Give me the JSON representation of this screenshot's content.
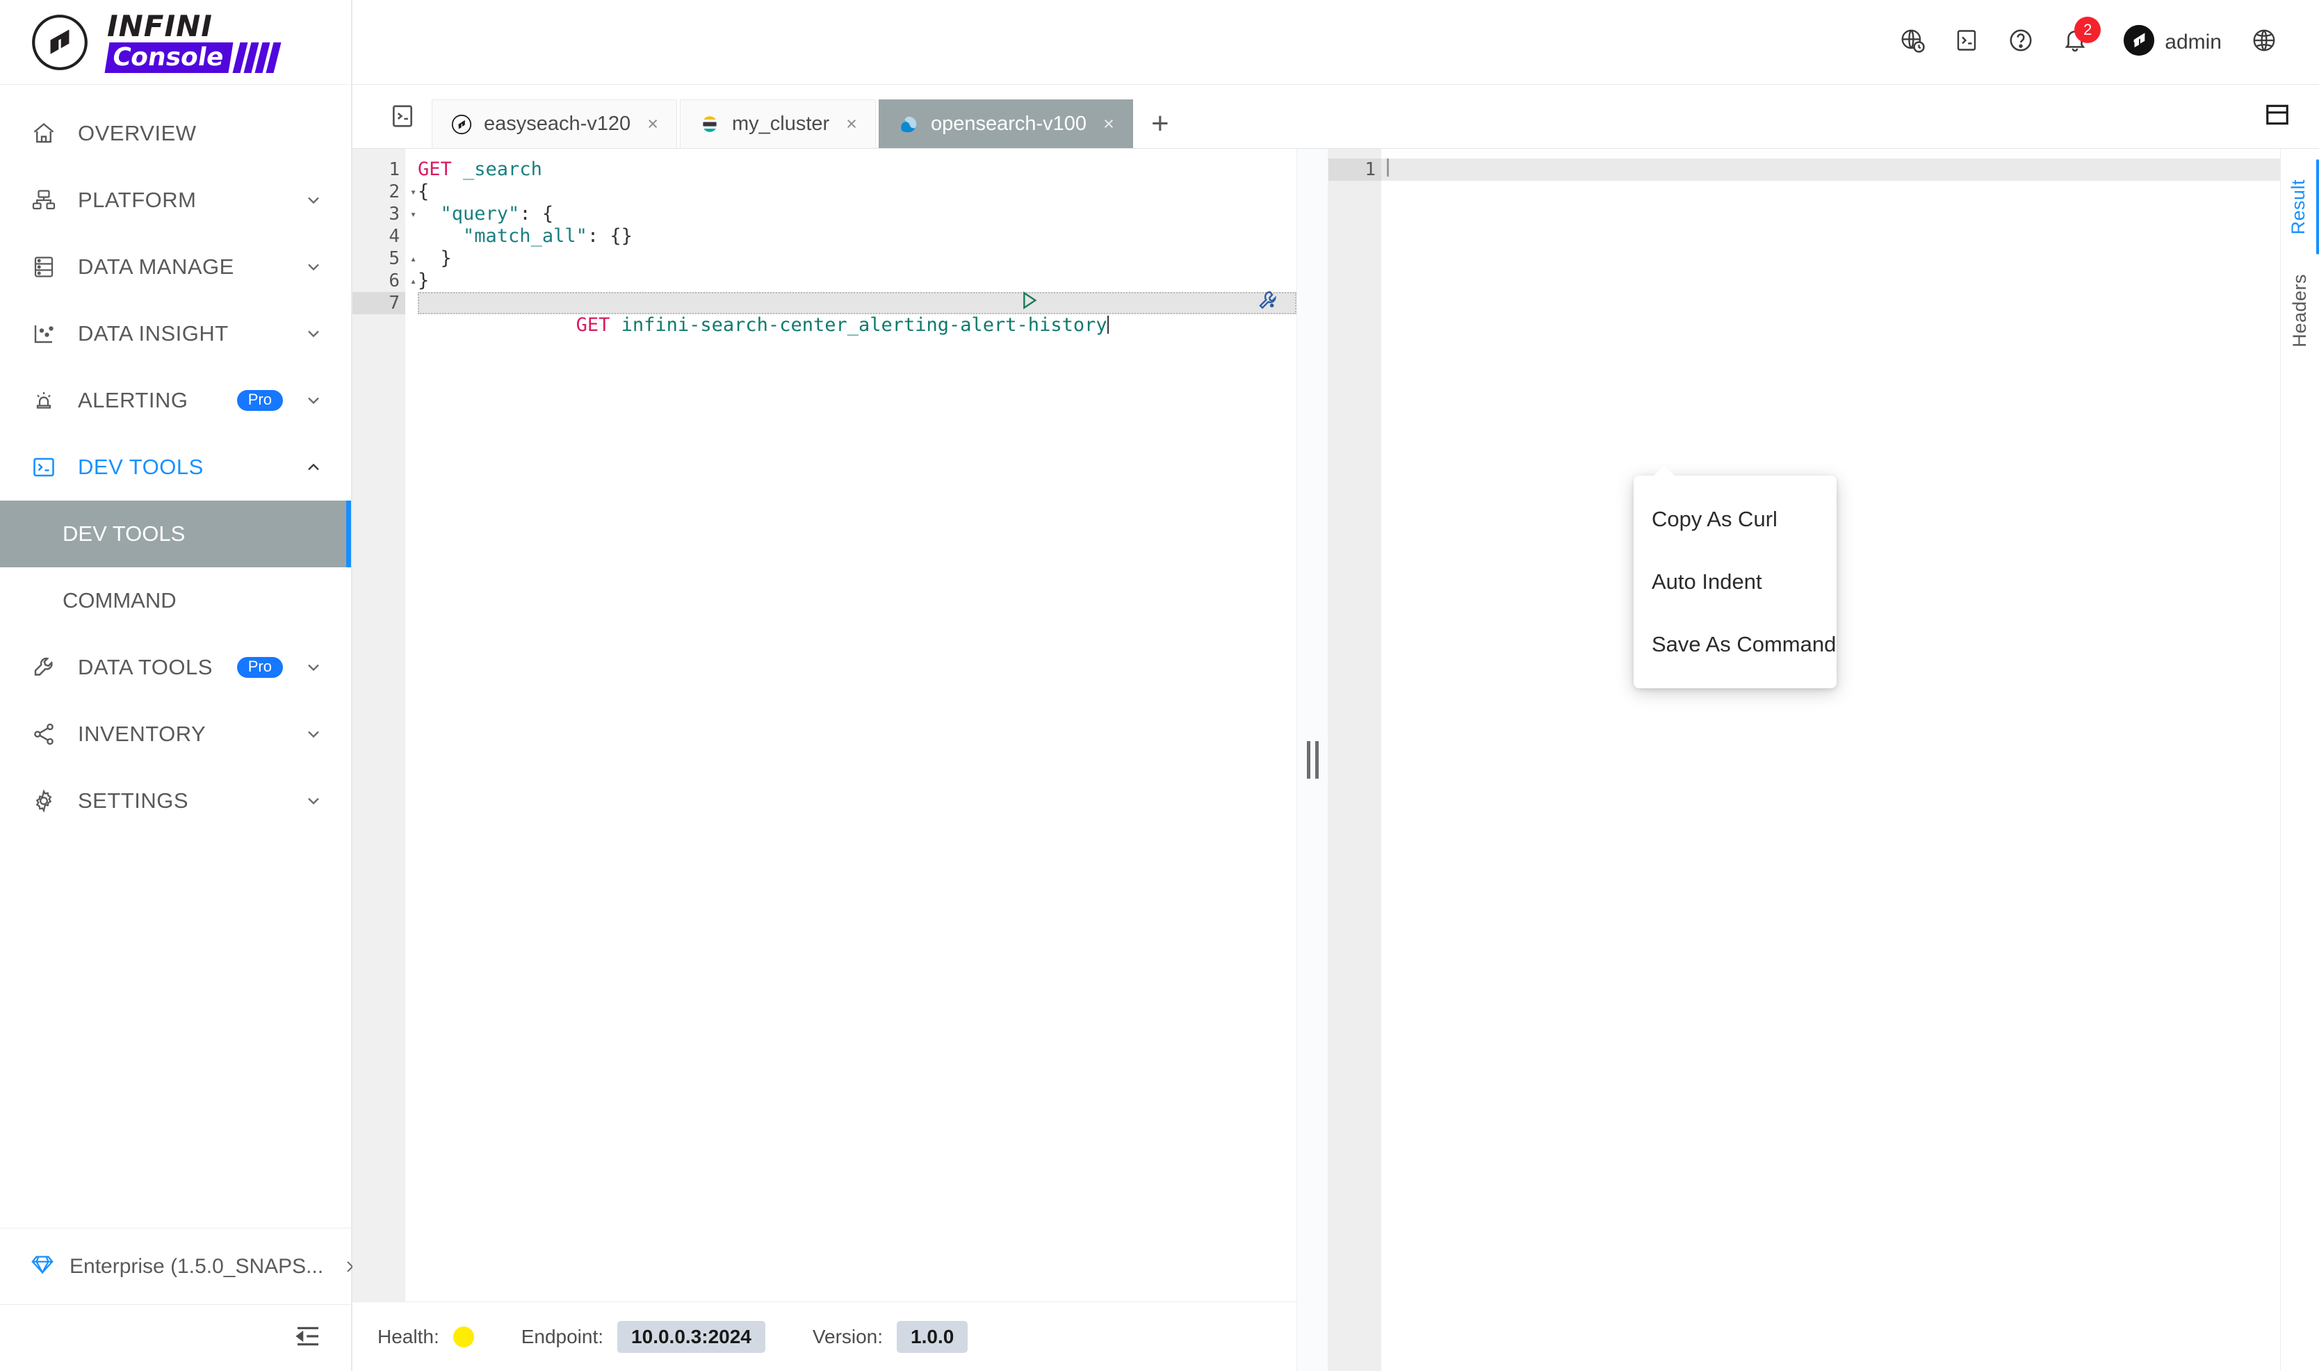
{
  "brand": {
    "name_top": "INFINI",
    "name_bottom": "Console",
    "accent_color": "#5106dd"
  },
  "sidebar": {
    "items": [
      {
        "label": "OVERVIEW",
        "icon": "home-icon",
        "expandable": false,
        "badge": ""
      },
      {
        "label": "PLATFORM",
        "icon": "platform-icon",
        "expandable": true,
        "badge": ""
      },
      {
        "label": "DATA MANAGE",
        "icon": "database-icon",
        "expandable": true,
        "badge": ""
      },
      {
        "label": "DATA INSIGHT",
        "icon": "chart-icon",
        "expandable": true,
        "badge": ""
      },
      {
        "label": "ALERTING",
        "icon": "alarm-icon",
        "expandable": true,
        "badge": "Pro"
      },
      {
        "label": "DEV TOOLS",
        "icon": "terminal-icon",
        "expandable": true,
        "badge": "",
        "active": true
      },
      {
        "label": "DATA TOOLS",
        "icon": "wrench-icon",
        "expandable": true,
        "badge": "Pro"
      },
      {
        "label": "INVENTORY",
        "icon": "share-icon",
        "expandable": true,
        "badge": ""
      },
      {
        "label": "SETTINGS",
        "icon": "gear-icon",
        "expandable": true,
        "badge": ""
      }
    ],
    "sub_items": [
      {
        "label": "DEV TOOLS",
        "selected": true
      },
      {
        "label": "COMMAND",
        "selected": false
      }
    ],
    "footer": {
      "label": "Enterprise (1.5.0_SNAPS...",
      "icon": "diamond-icon"
    },
    "collapse_icon": "collapse-sidebar-icon"
  },
  "topbar": {
    "icons": [
      "globe-clock-icon",
      "terminal-icon",
      "help-icon",
      "bell-icon"
    ],
    "notification_count": "2",
    "user_name": "admin",
    "language_icon": "language-globe-icon"
  },
  "tabbar": {
    "left_icon": "console-terminal-icon",
    "tabs": [
      {
        "label": "easyseach-v120",
        "icon": "infini-icon",
        "active": false,
        "close": "×"
      },
      {
        "label": "my_cluster",
        "icon": "elasticsearch-icon",
        "active": false,
        "close": "×"
      },
      {
        "label": "opensearch-v100",
        "icon": "opensearch-icon",
        "active": true,
        "close": "×"
      }
    ],
    "add_label": "+",
    "layout_icon": "split-layout-icon"
  },
  "editor": {
    "lines": [
      {
        "no": "1",
        "fold": "",
        "current": false,
        "tokens": [
          {
            "t": "GET",
            "c": "kw"
          },
          {
            "t": " _search",
            "c": "str"
          }
        ]
      },
      {
        "no": "2",
        "fold": "▾",
        "current": false,
        "tokens": [
          {
            "t": "{",
            "c": "pn"
          }
        ]
      },
      {
        "no": "3",
        "fold": "▾",
        "current": false,
        "tokens": [
          {
            "t": "  ",
            "c": "pn"
          },
          {
            "t": "\"query\"",
            "c": "str"
          },
          {
            "t": ": {",
            "c": "pn"
          }
        ]
      },
      {
        "no": "4",
        "fold": "",
        "current": false,
        "tokens": [
          {
            "t": "    ",
            "c": "pn"
          },
          {
            "t": "\"match_all\"",
            "c": "str"
          },
          {
            "t": ": {}",
            "c": "pn"
          }
        ]
      },
      {
        "no": "5",
        "fold": "▴",
        "current": false,
        "tokens": [
          {
            "t": "  }",
            "c": "pn"
          }
        ]
      },
      {
        "no": "6",
        "fold": "▴",
        "current": false,
        "tokens": [
          {
            "t": "}",
            "c": "pn"
          }
        ]
      },
      {
        "no": "7",
        "fold": "",
        "current": true,
        "tokens": [
          {
            "t": "GET",
            "c": "kw"
          },
          {
            "t": " infini-search-center_alerting-alert-history",
            "c": "path"
          }
        ]
      }
    ],
    "actions": {
      "run_icon": "run-play-icon",
      "tools_icon": "wrench-icon"
    }
  },
  "context_menu": {
    "items": [
      {
        "label": "Copy As Curl"
      },
      {
        "label": "Auto Indent"
      },
      {
        "label": "Save As Command"
      }
    ]
  },
  "result": {
    "lines": [
      {
        "no": "1"
      }
    ],
    "tabs": [
      {
        "label": "Result",
        "active": true
      },
      {
        "label": "Headers",
        "active": false
      }
    ]
  },
  "statusbar": {
    "health_label": "Health:",
    "health_color": "#ffec00",
    "endpoint_label": "Endpoint:",
    "endpoint_value": "10.0.0.3:2024",
    "version_label": "Version:",
    "version_value": "1.0.0"
  }
}
